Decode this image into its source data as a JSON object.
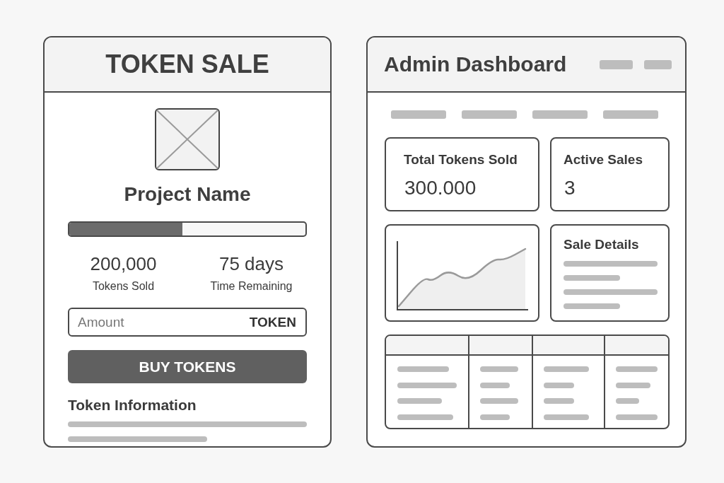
{
  "token_sale": {
    "title": "TOKEN SALE",
    "project_name": "Project Name",
    "progress": {
      "level": 0.48
    },
    "stats": [
      {
        "value": "200,000",
        "label": "Tokens Sold"
      },
      {
        "value": "75 days",
        "label": "Time Remaining"
      }
    ],
    "amount_field": {
      "placeholder": "Amount",
      "unit": "TOKEN"
    },
    "buy_button": "BUY TOKENS",
    "info_heading": "Token Information"
  },
  "admin_dashboard": {
    "title": "Admin Dashboard",
    "stat_cards": [
      {
        "label": "Total Tokens Sold",
        "value": "300.000"
      },
      {
        "label": "Active Sales",
        "value": "3"
      }
    ],
    "details_card": {
      "title": "Sale Details"
    }
  }
}
